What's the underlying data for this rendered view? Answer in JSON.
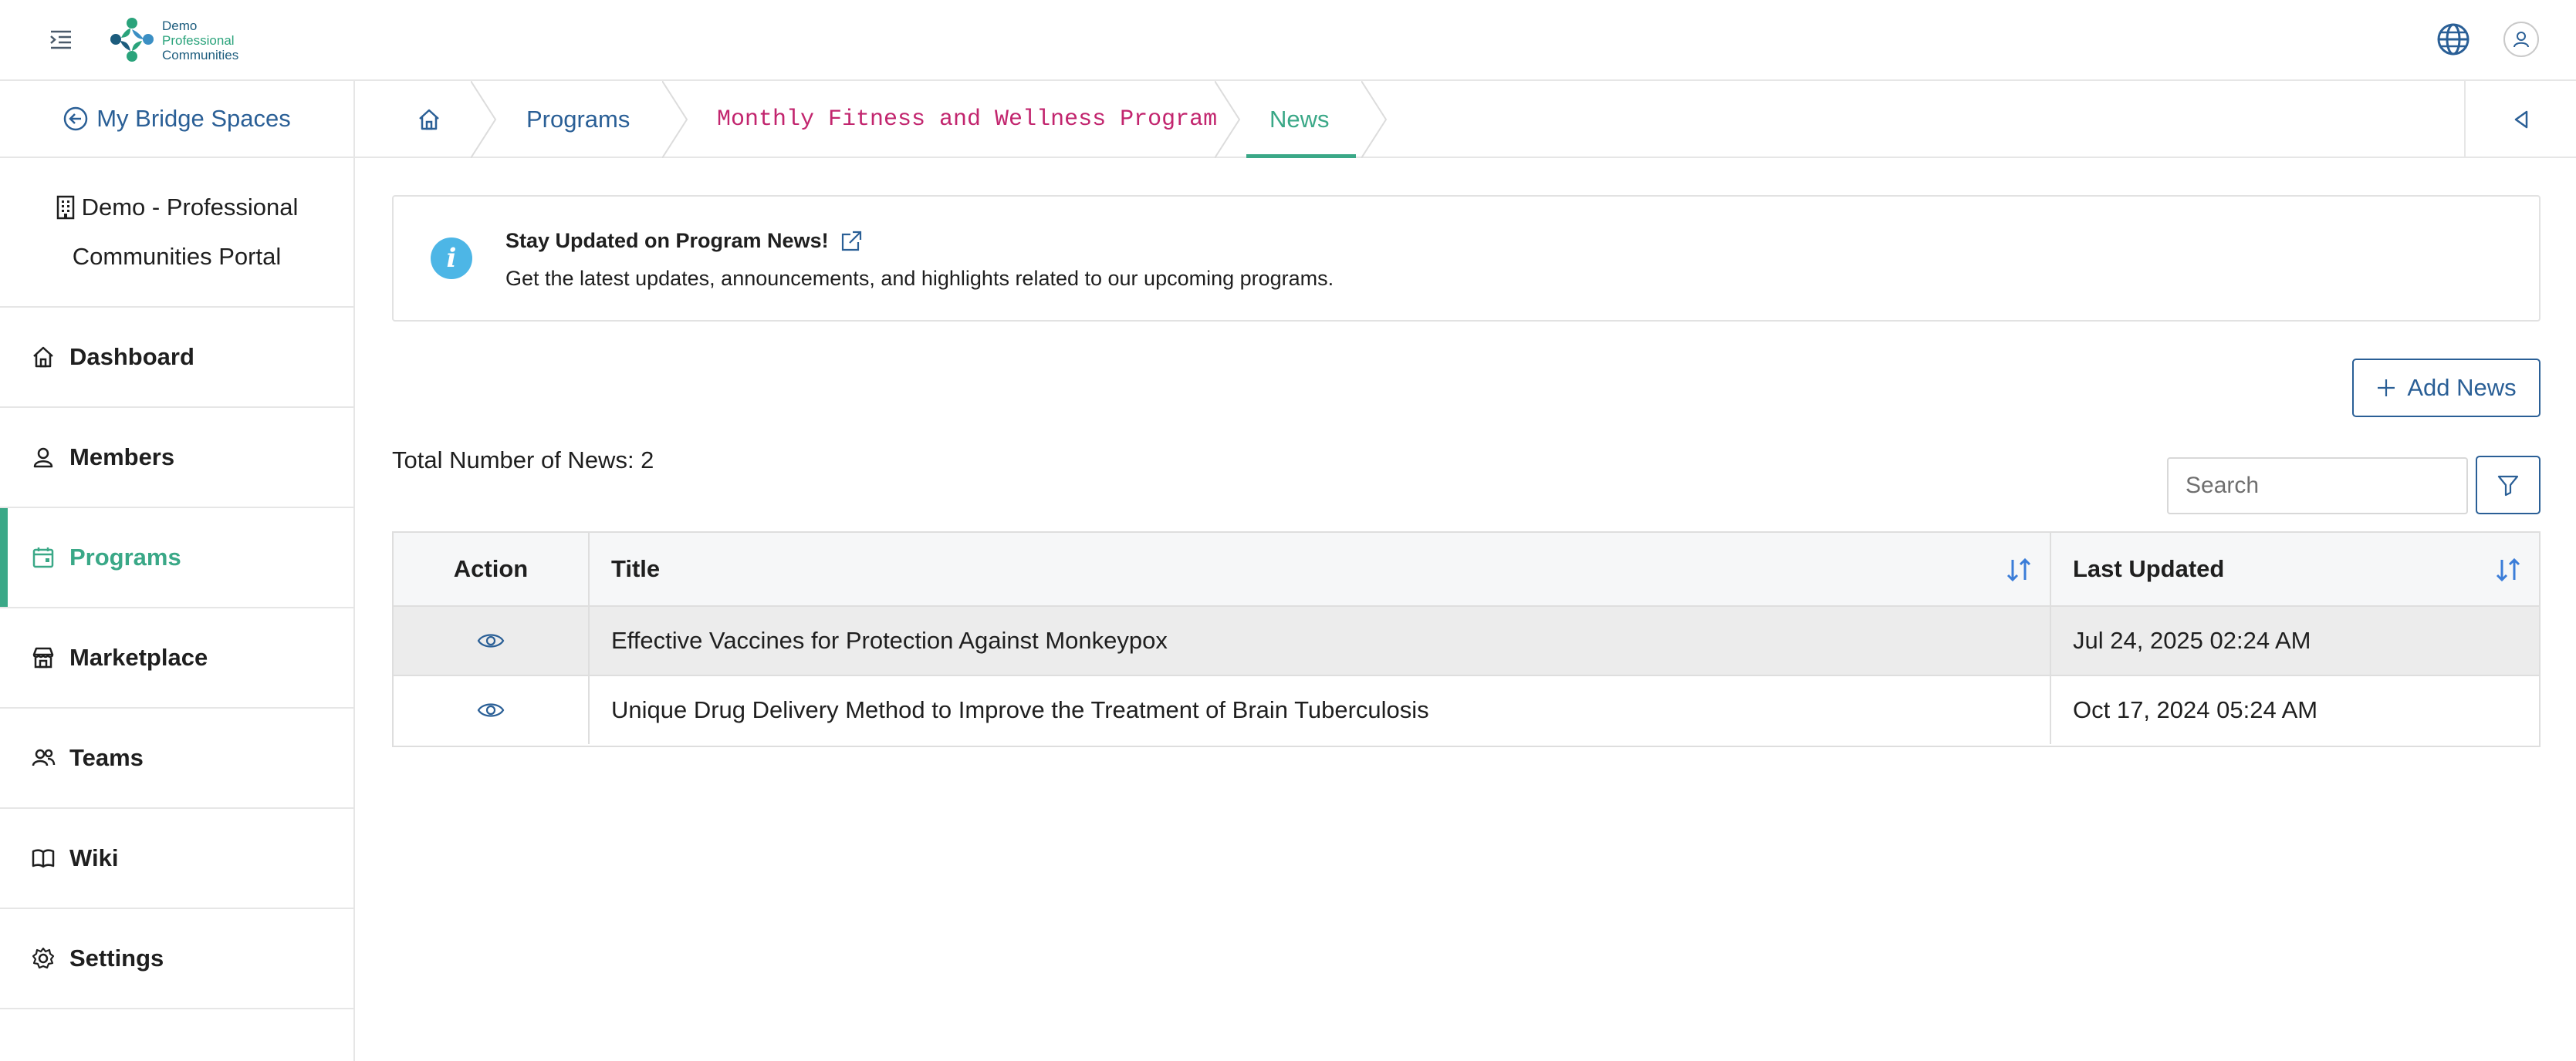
{
  "header": {
    "logo_text": [
      "Demo",
      "Professional",
      "Communities"
    ],
    "menu_toggle_icon": "menu-collapse-icon",
    "language_icon": "globe-icon",
    "user_icon": "user-icon"
  },
  "sidebar": {
    "back_label": "My Bridge Spaces",
    "portal_line1": "Demo - Professional",
    "portal_line2": "Communities Portal",
    "items": [
      {
        "label": "Dashboard",
        "icon": "home-icon",
        "active": false
      },
      {
        "label": "Members",
        "icon": "user-icon",
        "active": false
      },
      {
        "label": "Programs",
        "icon": "calendar-icon",
        "active": true
      },
      {
        "label": "Marketplace",
        "icon": "store-icon",
        "active": false
      },
      {
        "label": "Teams",
        "icon": "users-icon",
        "active": false
      },
      {
        "label": "Wiki",
        "icon": "book-icon",
        "active": false
      },
      {
        "label": "Settings",
        "icon": "gear-icon",
        "active": false
      }
    ]
  },
  "breadcrumb": {
    "home_icon": "home-icon",
    "programs": "Programs",
    "program": "Monthly Fitness and Wellness Program",
    "current": "News"
  },
  "banner": {
    "title": "Stay Updated on Program News!",
    "text": "Get the latest updates, announcements, and highlights related to our upcoming programs."
  },
  "actions": {
    "add_label": "Add News",
    "search_placeholder": "Search"
  },
  "summary": {
    "total_text": "Total Number of News: 2"
  },
  "table": {
    "columns": [
      "Action",
      "Title",
      "Last Updated"
    ],
    "rows": [
      {
        "title": "Effective Vaccines for Protection Against Monkeypox",
        "updated": "Jul 24, 2025 02:24 AM"
      },
      {
        "title": "Unique Drug Delivery Method to Improve the Treatment of Brain Tuberculosis",
        "updated": "Oct 17, 2024 05:24 AM"
      }
    ]
  },
  "colors": {
    "primary": "#2a5f96",
    "accent_green": "#3aa887",
    "program_link": "#c2256e",
    "info_icon": "#4db6e6"
  }
}
